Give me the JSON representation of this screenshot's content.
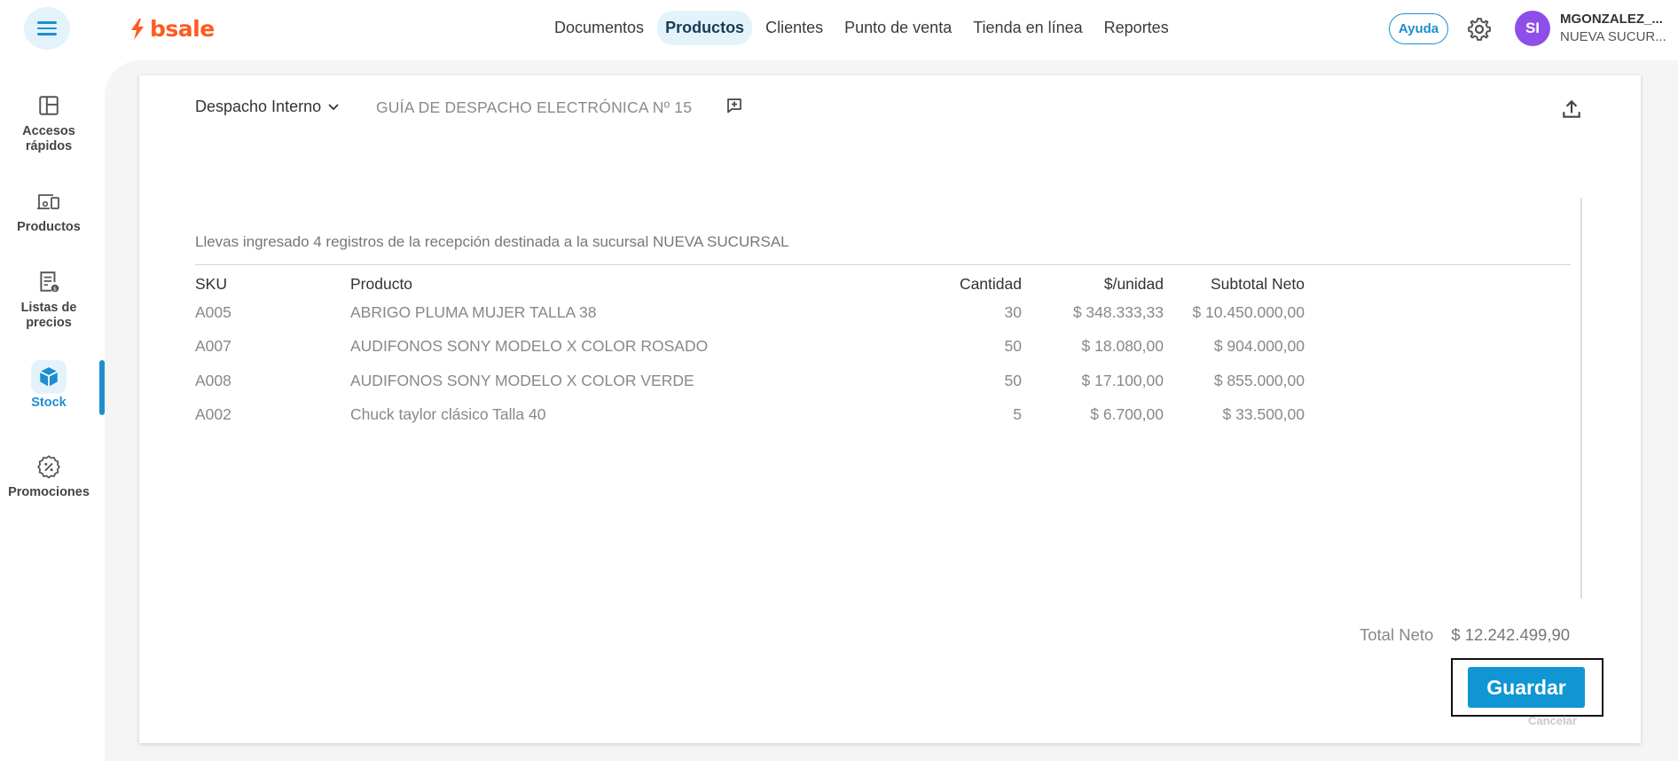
{
  "header": {
    "logo_text": "bsale",
    "nav": [
      "Documentos",
      "Productos",
      "Clientes",
      "Punto de venta",
      "Tienda en línea",
      "Reportes"
    ],
    "active_nav": "Productos",
    "help_label": "Ayuda",
    "avatar_initials": "SI",
    "user_name": "MGONZALEZ_...",
    "user_branch": "NUEVA SUCUR..."
  },
  "sidebar": {
    "items": [
      {
        "label_1": "Accesos",
        "label_2": "rápidos",
        "icon": "layout-icon"
      },
      {
        "label_1": "Productos",
        "label_2": "",
        "icon": "products-icon"
      },
      {
        "label_1": "Listas de",
        "label_2": "precios",
        "icon": "price-list-icon"
      },
      {
        "label_1": "Stock",
        "label_2": "",
        "icon": "stock-box-icon"
      },
      {
        "label_1": "Promociones",
        "label_2": "",
        "icon": "promotions-icon"
      }
    ],
    "active": "Stock"
  },
  "document": {
    "type": "Despacho Interno",
    "title": "GUÍA DE DESPACHO ELECTRÓNICA Nº 15",
    "info": "Llevas ingresado 4 registros de la recepción destinada a la sucursal NUEVA SUCURSAL"
  },
  "table": {
    "headers": {
      "sku": "SKU",
      "product": "Producto",
      "qty": "Cantidad",
      "unit": "$/unidad",
      "subtotal": "Subtotal Neto"
    },
    "rows": [
      {
        "sku": "A005",
        "product": "ABRIGO PLUMA MUJER TALLA 38",
        "qty": "30",
        "unit": "$ 348.333,33",
        "subtotal": "$ 10.450.000,00"
      },
      {
        "sku": "A007",
        "product": "AUDIFONOS SONY MODELO X COLOR ROSADO",
        "qty": "50",
        "unit": "$ 18.080,00",
        "subtotal": "$ 904.000,00"
      },
      {
        "sku": "A008",
        "product": "AUDIFONOS SONY MODELO X COLOR VERDE",
        "qty": "50",
        "unit": "$ 17.100,00",
        "subtotal": "$ 855.000,00"
      },
      {
        "sku": "A002",
        "product": "Chuck taylor clásico Talla 40",
        "qty": "5",
        "unit": "$ 6.700,00",
        "subtotal": "$ 33.500,00"
      }
    ]
  },
  "totals": {
    "label": "Total Neto",
    "value": "$ 12.242.499,90"
  },
  "actions": {
    "save_label": "Guardar",
    "cancel_label": "Cancelar"
  },
  "colors": {
    "accent": "#1d8fd0",
    "brand": "#ff5a1f",
    "avatar": "#8e4ee8",
    "save_button": "#1096d2"
  }
}
